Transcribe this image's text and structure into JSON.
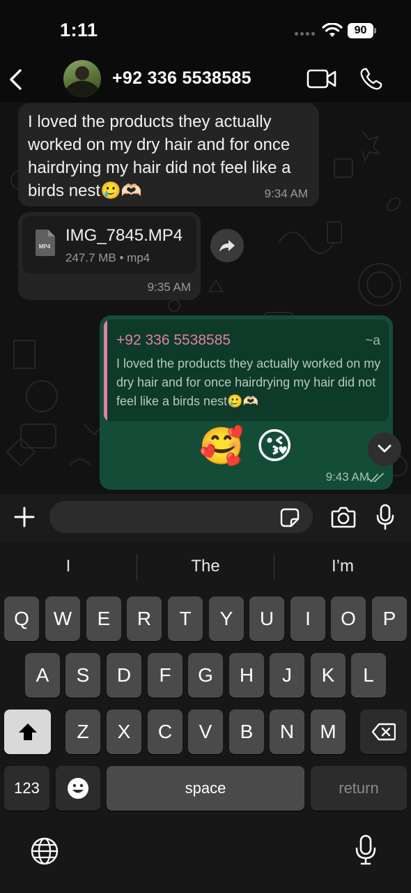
{
  "status_bar": {
    "time": "1:11",
    "battery": "90"
  },
  "header": {
    "contact_name": "+92 336 5538585",
    "icons": [
      "back-icon",
      "avatar",
      "video-icon",
      "call-icon"
    ]
  },
  "messages": {
    "incoming_text": {
      "text": "I loved the products they actually worked on my dry hair and for once hairdrying my hair did not feel like a birds nest🥲🫶🏻",
      "time": "9:34 AM"
    },
    "incoming_file": {
      "file_label": "MP4",
      "file_name": "IMG_7845.MP4",
      "file_meta": "247.7 MB • mp4",
      "time": "9:35 AM"
    },
    "outgoing_reply": {
      "quote_author": "+92 336 5538585",
      "quote_tag": "~a",
      "quote_text": "I loved the products they actually worked on my dry hair and for once hairdrying my hair did not feel like a birds nest🥲🫶🏻",
      "emojis": "🥰 😘",
      "time": "9:43 AM",
      "status": "read"
    }
  },
  "input": {
    "placeholder": ""
  },
  "keyboard": {
    "suggestions": [
      "I",
      "The",
      "I’m"
    ],
    "row1": [
      "Q",
      "W",
      "E",
      "R",
      "T",
      "Y",
      "U",
      "I",
      "O",
      "P"
    ],
    "row2": [
      "A",
      "S",
      "D",
      "F",
      "G",
      "H",
      "J",
      "K",
      "L"
    ],
    "row3": [
      "Z",
      "X",
      "C",
      "V",
      "B",
      "N",
      "M"
    ],
    "numbers_key": "123",
    "space_key": "space",
    "return_key": "return"
  },
  "colors": {
    "outgoing_bubble": "#134d37",
    "incoming_bubble": "#242424",
    "quote_accent": "#e57fa4",
    "read_check": "#a7c2b4"
  }
}
